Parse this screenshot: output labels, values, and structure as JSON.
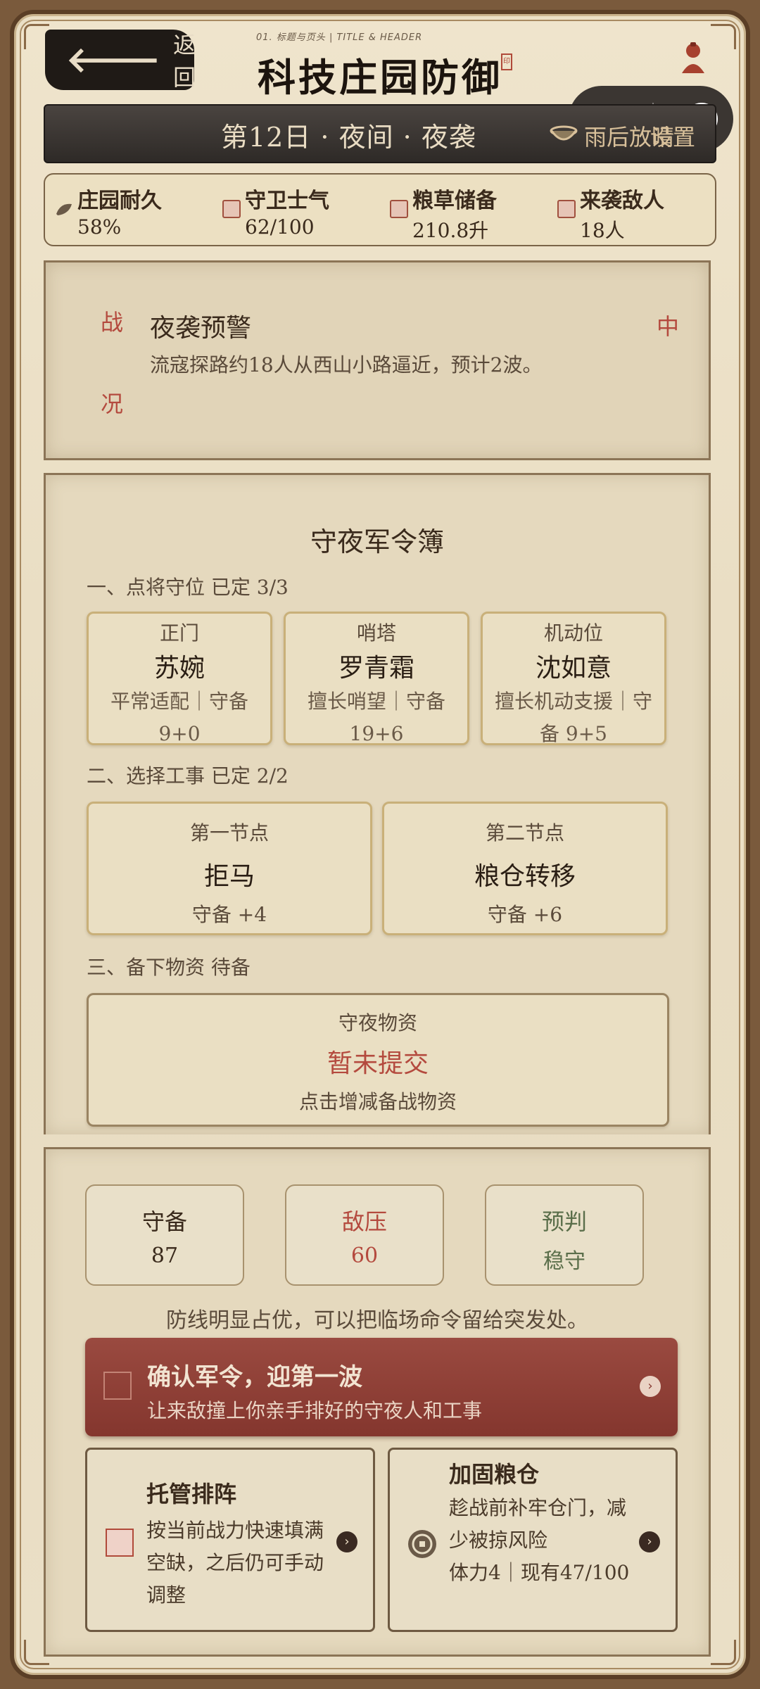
{
  "header": {
    "back_label": "返回",
    "caption": "01. 标题与页头 | TITLE & HEADER",
    "title": "科技庄园防御",
    "seal": "印"
  },
  "daybar": {
    "day": "第12日 · 夜间 · 夜袭",
    "weather": "雨后放晴",
    "settings": "设置"
  },
  "stats": [
    {
      "label": "庄园耐久",
      "value": "58%"
    },
    {
      "label": "守卫士气",
      "value": "62/100"
    },
    {
      "label": "粮草储备",
      "value": "210.8升"
    },
    {
      "label": "来袭敌人",
      "value": "18人"
    }
  ],
  "alert": {
    "vertical_1": "战",
    "vertical_2": "况",
    "title": "夜袭预警",
    "level": "中",
    "desc": "流寇探路约18人从西山小路逼近，预计2波。"
  },
  "orders": {
    "title": "守夜军令簿",
    "section1": "一、点将守位  已定 3/3",
    "posts": [
      {
        "pos": "正门",
        "name": "苏婉",
        "desc": "平常适配｜守备 9+0"
      },
      {
        "pos": "哨塔",
        "name": "罗青霜",
        "desc": "擅长哨望｜守备 19+6"
      },
      {
        "pos": "机动位",
        "name": "沈如意",
        "desc": "擅长机动支援｜守备 9+5"
      }
    ],
    "section2": "二、选择工事  已定 2/2",
    "works": [
      {
        "node": "第一节点",
        "name": "拒马",
        "bonus": "守备 +4"
      },
      {
        "node": "第二节点",
        "name": "粮仓转移",
        "bonus": "守备 +6"
      }
    ],
    "section3": "三、备下物资  待备",
    "supply": {
      "label": "守夜物资",
      "status": "暂未提交",
      "hint": "点击增减备战物资"
    }
  },
  "summary": {
    "metrics": [
      {
        "label": "守备",
        "value": "87"
      },
      {
        "label": "敌压",
        "value": "60"
      },
      {
        "label": "预判",
        "value": "稳守"
      }
    ],
    "note": "防线明显占优，可以把临场命令留给突发处。",
    "confirm": {
      "title": "确认军令，迎第一波",
      "sub": "让来敌撞上你亲手排好的守夜人和工事"
    },
    "auto": {
      "title": "托管排阵",
      "desc": "按当前战力快速填满空缺，之后仍可手动调整"
    },
    "reinforce": {
      "title": "加固粮仓",
      "desc": "趁战前补牢仓门，减少被掠风险",
      "cost": "体力4｜现有47/100"
    }
  },
  "colors": {
    "accent_red": "#b44a3e",
    "confirm_bg": "#8f3f36",
    "dark_bar": "#2e2a27",
    "paper": "#e5d9be"
  },
  "icons": [
    "back-arrow-icon",
    "avatar-icon",
    "more-dots-icon",
    "target-icon",
    "weather-bowl-icon",
    "seal-icon",
    "chevron-right-icon",
    "coin-icon"
  ]
}
